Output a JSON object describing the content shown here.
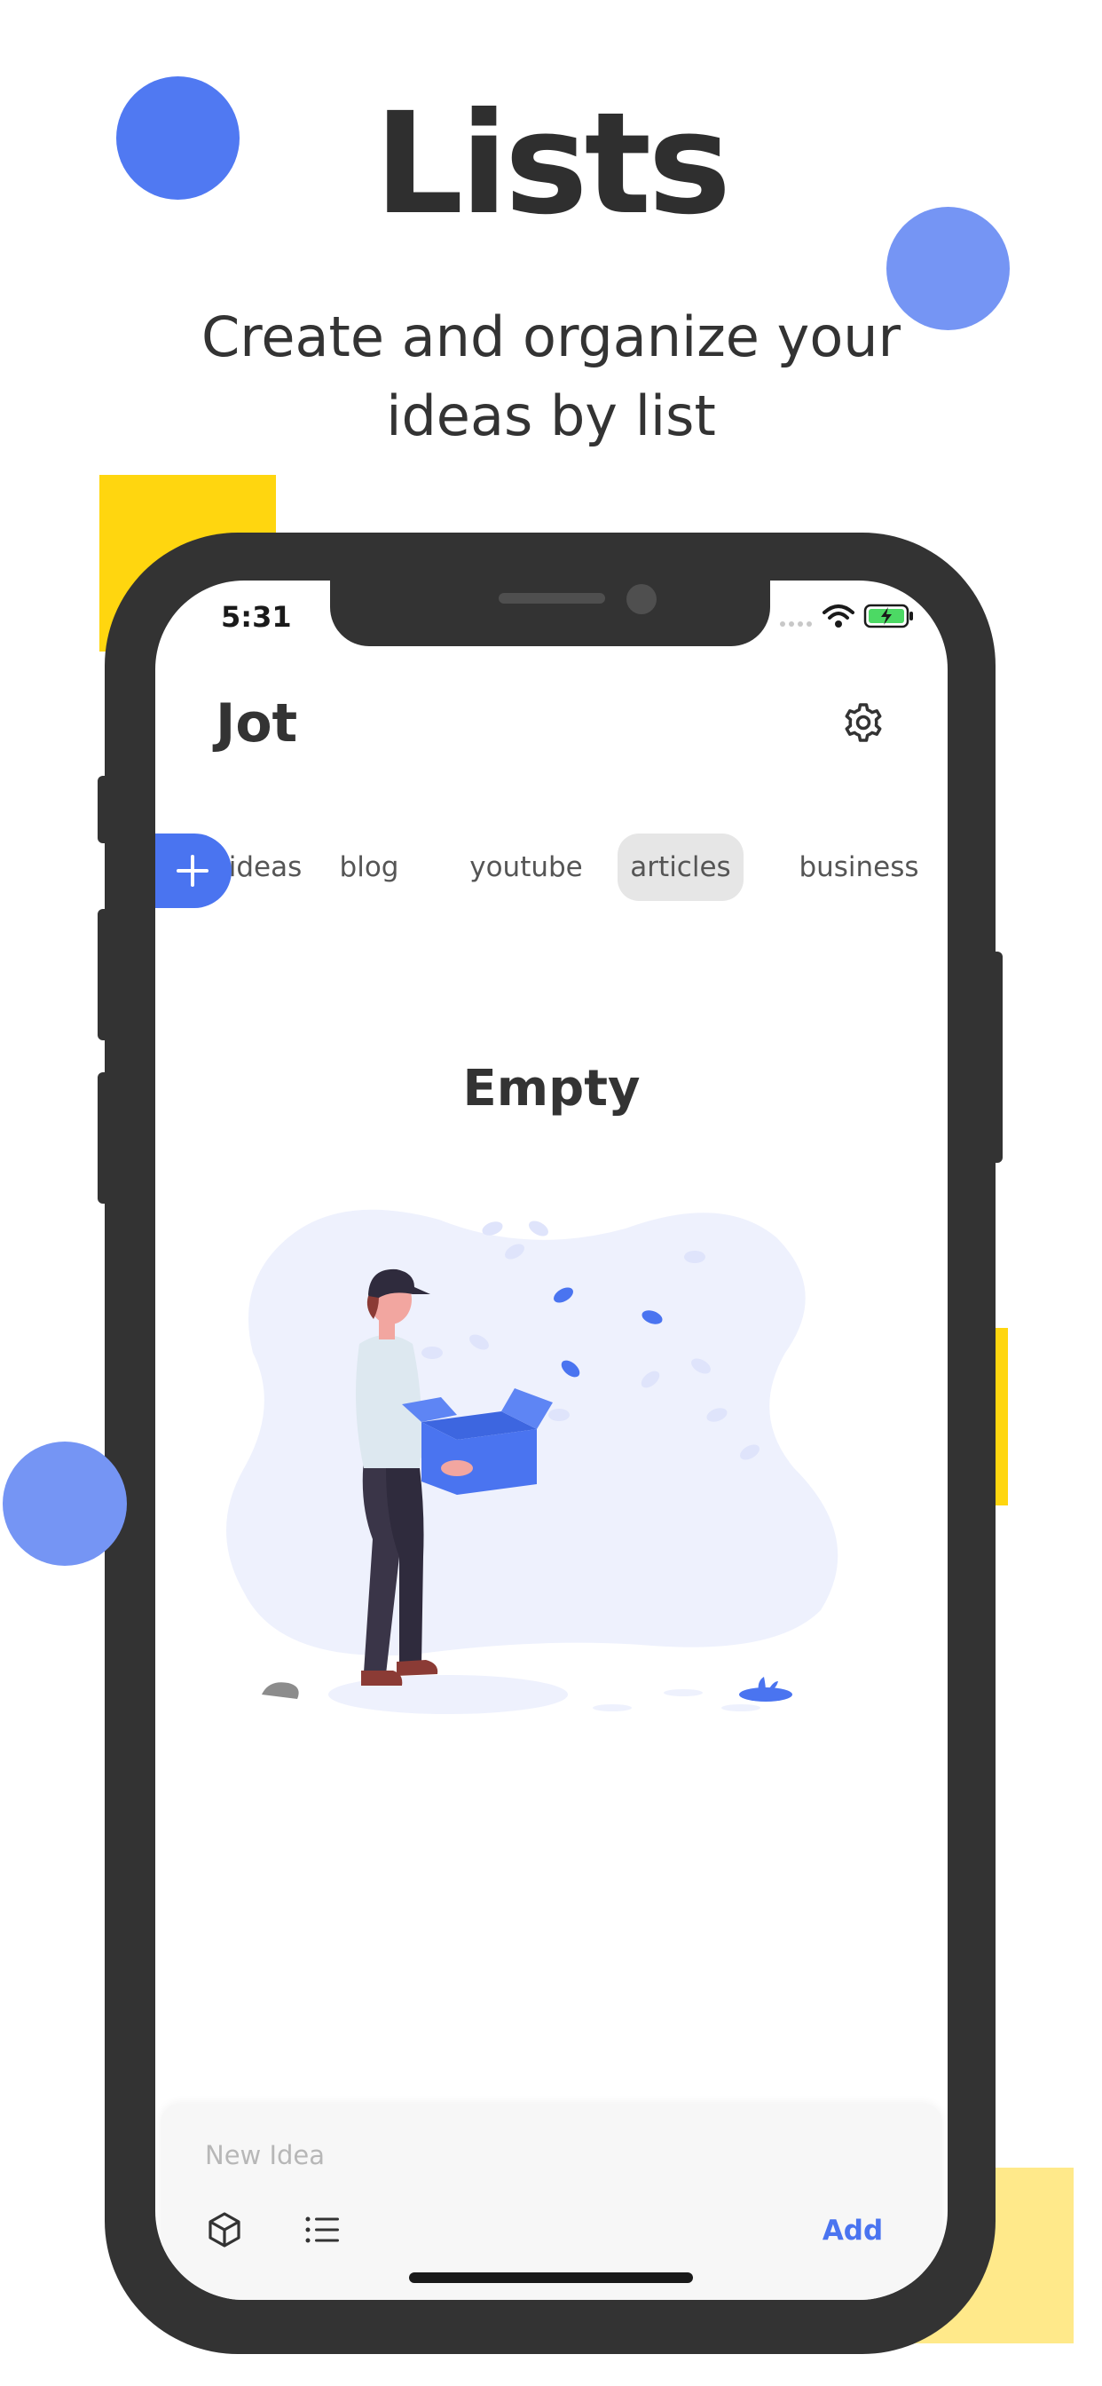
{
  "marketing": {
    "headline": "Lists",
    "subtitle": "Create and organize your ideas by list"
  },
  "status_bar": {
    "time": "5:31"
  },
  "app": {
    "title": "Jot"
  },
  "tabs": [
    {
      "label": "ideas"
    },
    {
      "label": "blog"
    },
    {
      "label": "youtube"
    },
    {
      "label": "articles",
      "selected": true
    },
    {
      "label": "business"
    }
  ],
  "empty_state": {
    "title": "Empty"
  },
  "composer": {
    "placeholder": "New Idea",
    "add_label": "Add"
  },
  "colors": {
    "accent": "#4a74f0",
    "yellow": "#ffd60f",
    "dark": "#333333",
    "tab_selected_bg": "#e6e6e6"
  },
  "icons": {
    "settings": "gear-icon",
    "add_list": "plus-icon",
    "box": "box-icon",
    "list": "list-icon",
    "signal": "cellular-signal-icon",
    "wifi": "wifi-icon",
    "battery": "battery-charging-icon"
  }
}
